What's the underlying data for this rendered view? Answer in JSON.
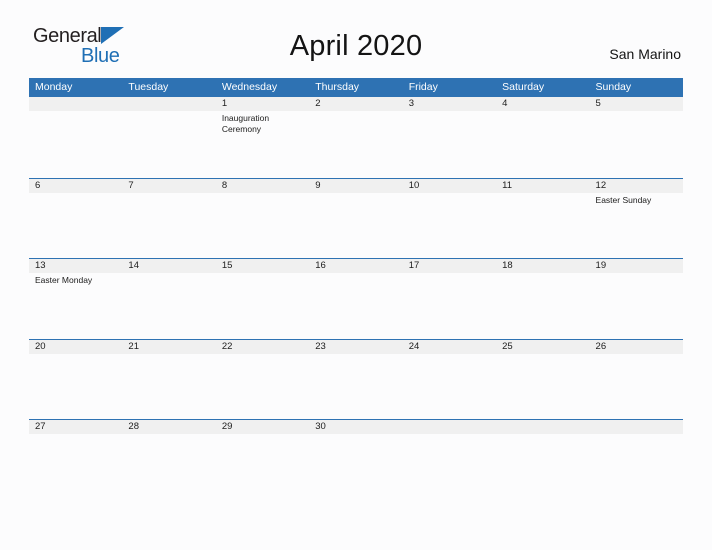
{
  "brand": {
    "word_one": "General",
    "word_two": "Blue",
    "flag_icon": "blue-triangle-flag-icon",
    "colors": {
      "dark": "#231f20",
      "blue": "#1f6fb5"
    }
  },
  "header": {
    "title": "April 2020",
    "locale": "San Marino"
  },
  "theme": {
    "header_blue": "#2e72b3",
    "rule_blue": "#2e72b3",
    "band_gray": "#f0f0f0",
    "page_background": "#fcfcfd",
    "text": "#202020"
  },
  "calendar": {
    "weekdays": [
      "Monday",
      "Tuesday",
      "Wednesday",
      "Thursday",
      "Friday",
      "Saturday",
      "Sunday"
    ],
    "weeks": [
      [
        {
          "number": "",
          "events": []
        },
        {
          "number": "",
          "events": []
        },
        {
          "number": "1",
          "events": [
            "Inauguration",
            "Ceremony"
          ]
        },
        {
          "number": "2",
          "events": []
        },
        {
          "number": "3",
          "events": []
        },
        {
          "number": "4",
          "events": []
        },
        {
          "number": "5",
          "events": []
        }
      ],
      [
        {
          "number": "6",
          "events": []
        },
        {
          "number": "7",
          "events": []
        },
        {
          "number": "8",
          "events": []
        },
        {
          "number": "9",
          "events": []
        },
        {
          "number": "10",
          "events": []
        },
        {
          "number": "11",
          "events": []
        },
        {
          "number": "12",
          "events": [
            "Easter Sunday"
          ]
        }
      ],
      [
        {
          "number": "13",
          "events": [
            "Easter Monday"
          ]
        },
        {
          "number": "14",
          "events": []
        },
        {
          "number": "15",
          "events": []
        },
        {
          "number": "16",
          "events": []
        },
        {
          "number": "17",
          "events": []
        },
        {
          "number": "18",
          "events": []
        },
        {
          "number": "19",
          "events": []
        }
      ],
      [
        {
          "number": "20",
          "events": []
        },
        {
          "number": "21",
          "events": []
        },
        {
          "number": "22",
          "events": []
        },
        {
          "number": "23",
          "events": []
        },
        {
          "number": "24",
          "events": []
        },
        {
          "number": "25",
          "events": []
        },
        {
          "number": "26",
          "events": []
        }
      ],
      [
        {
          "number": "27",
          "events": []
        },
        {
          "number": "28",
          "events": []
        },
        {
          "number": "29",
          "events": []
        },
        {
          "number": "30",
          "events": []
        },
        {
          "number": "",
          "events": []
        },
        {
          "number": "",
          "events": []
        },
        {
          "number": "",
          "events": []
        }
      ]
    ]
  }
}
